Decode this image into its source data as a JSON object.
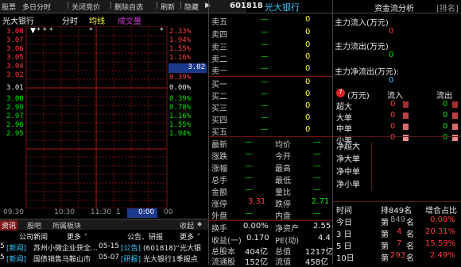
{
  "toolbar": {
    "item1": "股票",
    "item2": "多日分时",
    "item3": "关闭竞价",
    "item4": "删除自选",
    "item5": "刷新",
    "item6": "隐藏"
  },
  "chart_tabs": {
    "name": "光大银行",
    "tab1": "分时",
    "tab2": "均线",
    "tab3": "成交量"
  },
  "price_axis": [
    {
      "price": "3.08",
      "pct": "2.33%",
      "color": "red"
    },
    {
      "price": "3.07",
      "pct": "1.94%",
      "color": "red"
    },
    {
      "price": "3.06",
      "pct": "1.55%",
      "color": "red"
    },
    {
      "price": "3.05",
      "pct": "1.16%",
      "color": "red"
    },
    {
      "price": "3.04",
      "pct": "",
      "color": "red"
    },
    {
      "price": "3.02",
      "pct": "0.39%",
      "color": "red"
    },
    {
      "price": "3.01",
      "pct": "0.00%",
      "color": "white"
    },
    {
      "price": "3.00",
      "pct": "0.39%",
      "color": "green"
    },
    {
      "price": "2.99",
      "pct": "0.78%",
      "color": "green"
    },
    {
      "price": "2.97",
      "pct": "1.16%",
      "color": "green"
    },
    {
      "price": "2.96",
      "pct": "1.55%",
      "color": "green"
    },
    {
      "price": "2.95",
      "pct": "1.94%",
      "color": "green"
    }
  ],
  "current_price_box": "3.02",
  "time_axis": {
    "t1": "09:30",
    "t2": "10:30",
    "t3": "11:30",
    "t4": "1",
    "t5": "0:00",
    "t6": "00"
  },
  "news": {
    "tab_info": "资讯",
    "tab_bar": "股吧",
    "tab_sector": "所属板块",
    "collapse": "收起",
    "company_news": "公司新闻",
    "more1": "更多",
    "announce": "公告、研报",
    "more2": "更多",
    "item1_prefix": "5",
    "item1_tag": "[新闻]",
    "item1_text": "苏州小微企业获全...",
    "item1_date": "05-15",
    "item1_tag2": "[公告]",
    "item1_text2": "(601818)“光大银",
    "item2_prefix": "5",
    "item2_tag": "[新闻]",
    "item2_text": "国债销售马鞍山市",
    "item2_date": "05-07",
    "item2_tag2": "[研报]",
    "item2_text2": "光大银行1季报点"
  },
  "stock": {
    "code": "601818",
    "name": "光大银行"
  },
  "asks": [
    {
      "label": "卖五",
      "price": "—",
      "vol": "0"
    },
    {
      "label": "卖四",
      "price": "—",
      "vol": "0"
    },
    {
      "label": "卖三",
      "price": "—",
      "vol": "0"
    },
    {
      "label": "卖二",
      "price": "—",
      "vol": "0"
    },
    {
      "label": "卖一",
      "price": "—",
      "vol": "0"
    }
  ],
  "bids": [
    {
      "label": "买一",
      "price": "—",
      "vol": "0"
    },
    {
      "label": "买二",
      "price": "—",
      "vol": "0"
    },
    {
      "label": "买三",
      "price": "—",
      "vol": "0"
    },
    {
      "label": "买四",
      "price": "—",
      "vol": "0"
    },
    {
      "label": "买五",
      "price": "—",
      "vol": "0"
    }
  ],
  "quote": {
    "latest": "最新",
    "latest_v": "—",
    "avg": "均价",
    "avg_v": "—",
    "change": "涨跌",
    "change_v": "—",
    "open": "今开",
    "open_v": "—",
    "pct": "涨幅",
    "pct_v": "—",
    "high": "最高",
    "high_v": "—",
    "vol": "总手",
    "vol_v": "—",
    "low": "最低",
    "low_v": "—",
    "amount": "金额",
    "amount_v": "—",
    "ratio": "量比",
    "ratio_v": "—",
    "limitup": "涨停",
    "limitup_v": "3.31",
    "limitdown": "跌停",
    "limitdown_v": "2.71",
    "outer": "外盘",
    "outer_v": "—",
    "inner": "内盘",
    "inner_v": "—",
    "turnover": "换手",
    "turnover_v": "0.00%",
    "nav": "净资产",
    "nav_v": "2.55",
    "eps": "收益(一)",
    "eps_v": "0.170",
    "pe": "PE(动)",
    "pe_v": "4.4",
    "total_shares": "总股本",
    "total_shares_v": "404亿",
    "total_cap": "总值",
    "total_cap_v": "1217亿",
    "float_shares": "流通股",
    "float_shares_v": "152亿",
    "float_cap": "流值",
    "float_cap_v": "458亿"
  },
  "flow": {
    "header": "资金流分析",
    "rank_btn": "[排名]",
    "main_in": "主力流入(万元)",
    "main_in_v": "0",
    "main_out": "主力流出(万元)",
    "main_out_v": "0",
    "main_net": "主力净流出(万元):",
    "main_net_v": "0",
    "help": "?",
    "unit": "(万元)",
    "col_in": "流入",
    "col_out": "流出",
    "rows": [
      {
        "label": "超大",
        "in": "0",
        "out": "0"
      },
      {
        "label": "大单",
        "in": "0",
        "out": "0"
      },
      {
        "label": "中单",
        "in": "0",
        "out": "0"
      },
      {
        "label": "小单",
        "in": "0",
        "out": "0"
      }
    ],
    "net_rows": [
      "净超大",
      "净大单",
      "净中单",
      "净小单"
    ],
    "rank_header": {
      "time": "时间",
      "rank": "排849名",
      "rate": "增合占比"
    },
    "ranks": [
      {
        "period": "今日",
        "rank_prefix": "第",
        "rank_num": "849",
        "rank_suffix": "名",
        "rate": "0.00%",
        "rate_color": "red"
      },
      {
        "period": "3 日",
        "rank_prefix": "第",
        "rank_num": "4",
        "rank_suffix": "名",
        "rate": "20.31%",
        "rate_color": "red"
      },
      {
        "period": "5 日",
        "rank_prefix": "第",
        "rank_num": "7",
        "rank_suffix": "名",
        "rate": "15.59%",
        "rate_color": "red"
      },
      {
        "period": "10日",
        "rank_prefix": "第",
        "rank_num": "293",
        "rank_suffix": "名",
        "rate": "2.49%",
        "rate_color": "red"
      }
    ]
  },
  "colors": {
    "red": "#ff3c3c",
    "green": "#00e600",
    "grid": "#7a1010",
    "accent": "#38c8ff",
    "yellow": "#ffff3c"
  }
}
